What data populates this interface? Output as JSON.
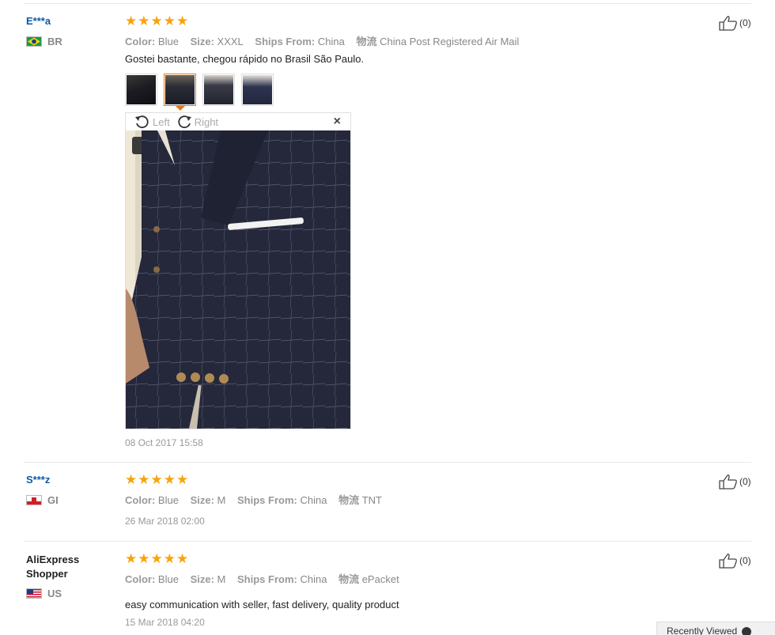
{
  "reviews": [
    {
      "user": "E***a",
      "country": "BR",
      "stars": 5,
      "color_label": "Color:",
      "color_value": "Blue",
      "size_label": "Size:",
      "size_value": "XXXL",
      "ships_label": "Ships From:",
      "ships_value": "China",
      "logistics_label": "物流",
      "logistics_value": "China Post Registered Air Mail",
      "text": "Gostei bastante, chegou rápido no Brasil São Paulo.",
      "date": "08 Oct 2017 15:58",
      "helpful": "(0)"
    },
    {
      "user": "S***z",
      "country": "GI",
      "stars": 5,
      "color_label": "Color:",
      "color_value": "Blue",
      "size_label": "Size:",
      "size_value": "M",
      "ships_label": "Ships From:",
      "ships_value": "China",
      "logistics_label": "物流",
      "logistics_value": "TNT",
      "text": "",
      "date": "26 Mar 2018 02:00",
      "helpful": "(0)"
    },
    {
      "user": "AliExpress Shopper",
      "country": "US",
      "stars": 5,
      "color_label": "Color:",
      "color_value": "Blue",
      "size_label": "Size:",
      "size_value": "M",
      "ships_label": "Ships From:",
      "ships_value": "China",
      "logistics_label": "物流",
      "logistics_value": "ePacket",
      "text": "easy communication with seller, fast delivery, quality product",
      "date": "15 Mar 2018 04:20",
      "helpful": "(0)"
    }
  ],
  "viewer": {
    "rotate_left": "Left",
    "rotate_right": "Right",
    "close": "×"
  },
  "recently_viewed": "Recently Viewed",
  "icons": {
    "star": "★",
    "thumb_up": "thumbs-up-icon",
    "rotate_left": "rotate-left-icon",
    "rotate_right": "rotate-right-icon"
  },
  "colors": {
    "star": "#f7a40c",
    "username": "#0b5aa8",
    "active_thumb": "#e2781e"
  }
}
